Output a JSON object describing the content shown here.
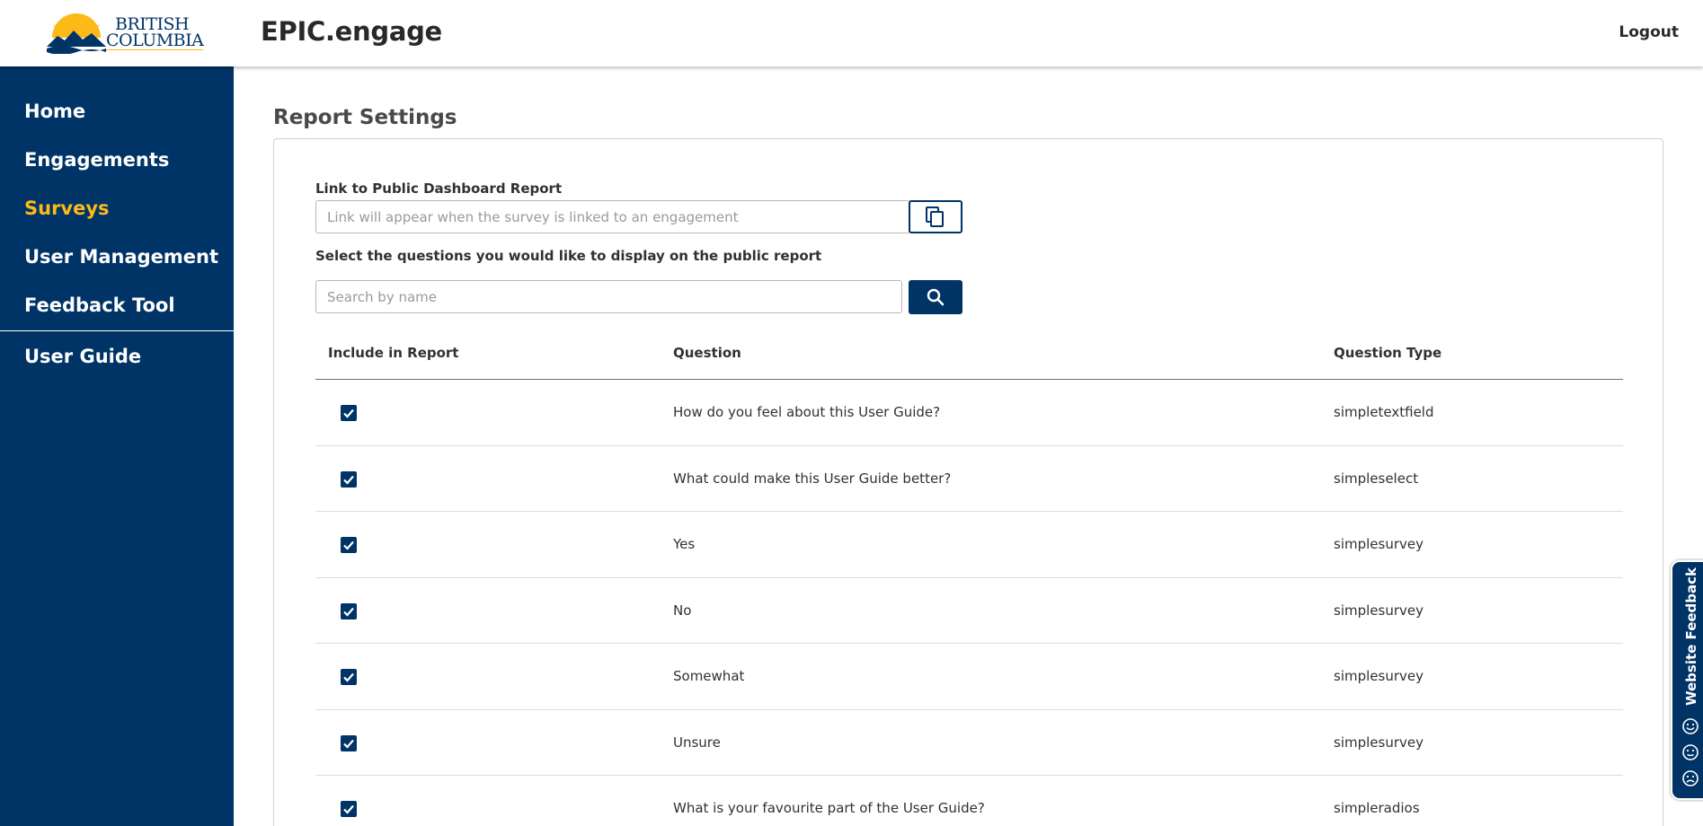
{
  "header": {
    "logo_line1": "BRITISH",
    "logo_line2": "COLUMBIA",
    "app_title": "EPIC.engage",
    "logout_label": "Logout"
  },
  "sidebar": {
    "items": [
      {
        "label": "Home",
        "active": false
      },
      {
        "label": "Engagements",
        "active": false
      },
      {
        "label": "Surveys",
        "active": true
      },
      {
        "label": "User Management",
        "active": false
      },
      {
        "label": "Feedback Tool",
        "active": false
      }
    ],
    "secondary_items": [
      {
        "label": "User Guide"
      }
    ]
  },
  "main": {
    "page_title": "Report Settings",
    "link_label": "Link to Public Dashboard Report",
    "link_placeholder": "Link will appear when the survey is linked to an engagement",
    "link_value": "",
    "select_label": "Select the questions you would like to display on the public report",
    "search_placeholder": "Search by name",
    "search_value": "",
    "table": {
      "columns": [
        "Include in Report",
        "Question",
        "Question Type"
      ],
      "rows": [
        {
          "included": true,
          "question": "How do you feel about this User Guide?",
          "type": "simpletextfield"
        },
        {
          "included": true,
          "question": "What could make this User Guide better?",
          "type": "simpleselect"
        },
        {
          "included": true,
          "question": "Yes",
          "type": "simplesurvey"
        },
        {
          "included": true,
          "question": "No",
          "type": "simplesurvey"
        },
        {
          "included": true,
          "question": "Somewhat",
          "type": "simplesurvey"
        },
        {
          "included": true,
          "question": "Unsure",
          "type": "simplesurvey"
        },
        {
          "included": true,
          "question": "What is your favourite part of the User Guide?",
          "type": "simpleradios"
        }
      ]
    }
  },
  "feedback_tab": {
    "label": "Website Feedback",
    "icons": [
      "smile-face-icon",
      "neutral-face-icon",
      "sad-face-icon"
    ]
  },
  "colors": {
    "primary": "#003366",
    "accent": "#fcba19",
    "text": "#313132"
  }
}
